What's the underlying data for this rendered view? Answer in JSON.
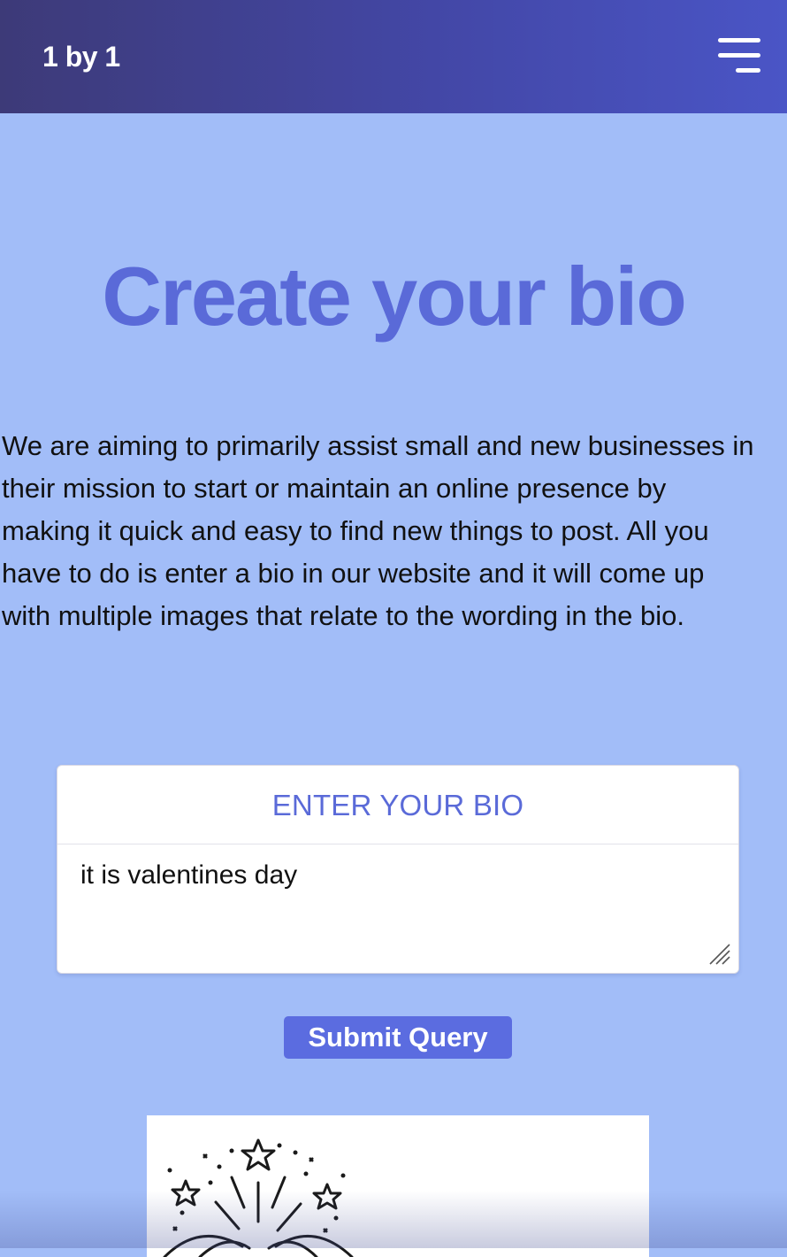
{
  "navbar": {
    "brand": "1 by 1",
    "menu_icon": "hamburger-menu-icon"
  },
  "hero": {
    "title": "Create your bio"
  },
  "intro": {
    "lines": [
      "We are aiming to primarily assist small and new businesses in",
      "their mission to start or maintain an online presence by",
      "making it quick and easy to find new things to post. All you",
      "have to do is enter a bio in our website and it will come up",
      "with multiple images that relate to the wording in the bio."
    ]
  },
  "bio_form": {
    "header": "ENTER YOUR BIO",
    "value": "it is valentines day",
    "resize_icon": "resize-grip-icon"
  },
  "submit": {
    "label": "Submit Query"
  },
  "results": {
    "image_icon": "fireworks-icon"
  },
  "colors": {
    "page_background": "#a2bdf8",
    "nav_gradient_start": "#3d3a78",
    "nav_gradient_end": "#4a55c6",
    "accent": "#5a6ad8",
    "button": "#5b6ce0"
  }
}
